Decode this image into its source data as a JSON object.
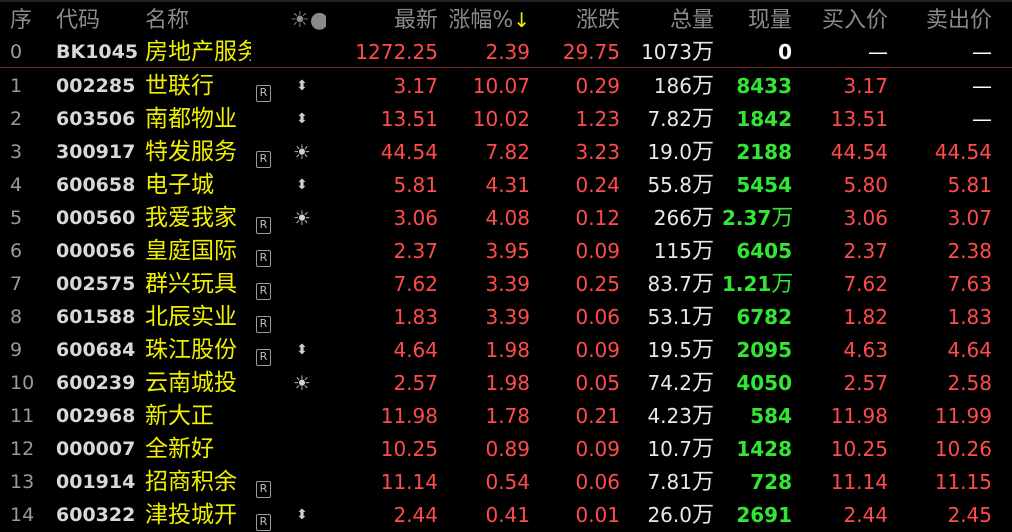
{
  "header": {
    "idx": "序",
    "code": "代码",
    "name": "名称",
    "star": "☀●",
    "last": "最新",
    "pct": "涨幅%",
    "sort_arrow": "↓",
    "chg": "涨跌",
    "vol": "总量",
    "now": "现量",
    "bid": "买入价",
    "ask": "卖出价"
  },
  "sector": {
    "idx": "0",
    "code": "BK1045",
    "name": "房地产服务",
    "last": "1272.25",
    "pct": "2.39",
    "chg": "29.75",
    "vol": "1073",
    "vol_unit": "万",
    "now": "0",
    "bid": "—",
    "ask": "—"
  },
  "rows": [
    {
      "idx": "1",
      "code": "002285",
      "name": "世联行",
      "r": "R",
      "star": "⬍",
      "last": "3.17",
      "pct": "10.07",
      "chg": "0.29",
      "vol": "186",
      "vol_unit": "万",
      "now": "8433",
      "now_unit": "",
      "bid": "3.17",
      "ask": "—"
    },
    {
      "idx": "2",
      "code": "603506",
      "name": "南都物业",
      "r": "",
      "star": "⬍",
      "last": "13.51",
      "pct": "10.02",
      "chg": "1.23",
      "vol": "7.82",
      "vol_unit": "万",
      "now": "1842",
      "now_unit": "",
      "bid": "13.51",
      "ask": "—"
    },
    {
      "idx": "3",
      "code": "300917",
      "name": "特发服务",
      "r": "R",
      "star": "☀",
      "last": "44.54",
      "pct": "7.82",
      "chg": "3.23",
      "vol": "19.0",
      "vol_unit": "万",
      "now": "2188",
      "now_unit": "",
      "bid": "44.54",
      "ask": "44.54"
    },
    {
      "idx": "4",
      "code": "600658",
      "name": "电子城",
      "r": "",
      "star": "⬍",
      "last": "5.81",
      "pct": "4.31",
      "chg": "0.24",
      "vol": "55.8",
      "vol_unit": "万",
      "now": "5454",
      "now_unit": "",
      "bid": "5.80",
      "ask": "5.81"
    },
    {
      "idx": "5",
      "code": "000560",
      "name": "我爱我家",
      "r": "R",
      "star": "☀",
      "last": "3.06",
      "pct": "4.08",
      "chg": "0.12",
      "vol": "266",
      "vol_unit": "万",
      "now": "2.37",
      "now_unit": "万",
      "bid": "3.06",
      "ask": "3.07"
    },
    {
      "idx": "6",
      "code": "000056",
      "name": "皇庭国际",
      "r": "R",
      "star": "",
      "last": "2.37",
      "pct": "3.95",
      "chg": "0.09",
      "vol": "115",
      "vol_unit": "万",
      "now": "6405",
      "now_unit": "",
      "bid": "2.37",
      "ask": "2.38"
    },
    {
      "idx": "7",
      "code": "002575",
      "name": "群兴玩具",
      "r": "R",
      "star": "",
      "last": "7.62",
      "pct": "3.39",
      "chg": "0.25",
      "vol": "83.7",
      "vol_unit": "万",
      "now": "1.21",
      "now_unit": "万",
      "bid": "7.62",
      "ask": "7.63"
    },
    {
      "idx": "8",
      "code": "601588",
      "name": "北辰实业",
      "r": "R",
      "star": "",
      "last": "1.83",
      "pct": "3.39",
      "chg": "0.06",
      "vol": "53.1",
      "vol_unit": "万",
      "now": "6782",
      "now_unit": "",
      "bid": "1.82",
      "ask": "1.83"
    },
    {
      "idx": "9",
      "code": "600684",
      "name": "珠江股份",
      "r": "R",
      "star": "⬍",
      "last": "4.64",
      "pct": "1.98",
      "chg": "0.09",
      "vol": "19.5",
      "vol_unit": "万",
      "now": "2095",
      "now_unit": "",
      "bid": "4.63",
      "ask": "4.64"
    },
    {
      "idx": "10",
      "code": "600239",
      "name": "云南城投",
      "r": "",
      "star": "☀",
      "last": "2.57",
      "pct": "1.98",
      "chg": "0.05",
      "vol": "74.2",
      "vol_unit": "万",
      "now": "4050",
      "now_unit": "",
      "bid": "2.57",
      "ask": "2.58"
    },
    {
      "idx": "11",
      "code": "002968",
      "name": "新大正",
      "r": "",
      "star": "",
      "last": "11.98",
      "pct": "1.78",
      "chg": "0.21",
      "vol": "4.23",
      "vol_unit": "万",
      "now": "584",
      "now_unit": "",
      "bid": "11.98",
      "ask": "11.99"
    },
    {
      "idx": "12",
      "code": "000007",
      "name": "全新好",
      "r": "",
      "star": "",
      "last": "10.25",
      "pct": "0.89",
      "chg": "0.09",
      "vol": "10.7",
      "vol_unit": "万",
      "now": "1428",
      "now_unit": "",
      "bid": "10.25",
      "ask": "10.26"
    },
    {
      "idx": "13",
      "code": "001914",
      "name": "招商积余",
      "r": "R",
      "star": "",
      "last": "11.14",
      "pct": "0.54",
      "chg": "0.06",
      "vol": "7.81",
      "vol_unit": "万",
      "now": "728",
      "now_unit": "",
      "bid": "11.14",
      "ask": "11.15"
    },
    {
      "idx": "14",
      "code": "600322",
      "name": "津投城开",
      "r": "R",
      "star": "⬍",
      "last": "2.44",
      "pct": "0.41",
      "chg": "0.01",
      "vol": "26.0",
      "vol_unit": "万",
      "now": "2691",
      "now_unit": "",
      "bid": "2.44",
      "ask": "2.45"
    }
  ],
  "colors": {
    "up": "#ff4b4b",
    "now_volume": "#33e633",
    "name": "#f0f000",
    "header": "#8a8a8a",
    "background": "#000000"
  }
}
